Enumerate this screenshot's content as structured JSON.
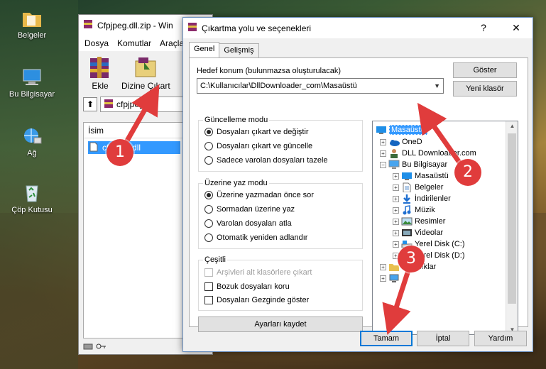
{
  "desktop": {
    "icons": [
      {
        "label": "Belgeler",
        "icon": "folder-icon"
      },
      {
        "label": "Bu Bilgisayar",
        "icon": "computer-icon"
      },
      {
        "label": "Ağ",
        "icon": "network-icon"
      },
      {
        "label": "Çöp Kutusu",
        "icon": "recycle-bin-icon"
      }
    ]
  },
  "winrar": {
    "title": "Cfpjpeg.dll.zip - Win",
    "menu": [
      "Dosya",
      "Komutlar",
      "Araçla"
    ],
    "toolbar": {
      "add_label": "Ekle",
      "extract_label": "Dizine Çıkart"
    },
    "path": "cfpjpeg.dll.",
    "column_name": "İsim",
    "file_name": "cfpjpeg.dll"
  },
  "dialog": {
    "title": "Çıkartma yolu ve seçenekleri",
    "help_btn": "?",
    "close_btn": "✕",
    "tabs": [
      "Genel",
      "Gelişmiş"
    ],
    "dest_label": "Hedef konum (bulunmazsa oluşturulacak)",
    "dest_value": "C:\\Kullanıcılar\\DllDownloader_com\\Masaüstü",
    "show_btn": "Göster",
    "new_folder_btn": "Yeni klasör",
    "update_mode": {
      "title": "Güncelleme modu",
      "options": [
        "Dosyaları çıkart ve değiştir",
        "Dosyaları çıkart ve güncelle",
        "Sadece varolan dosyaları tazele"
      ],
      "selected": 0
    },
    "overwrite_mode": {
      "title": "Üzerine yaz modu",
      "options": [
        "Üzerine yazmadan önce sor",
        "Sormadan üzerine yaz",
        "Varolan dosyaları atla",
        "Otomatik yeniden adlandır"
      ],
      "selected": 0
    },
    "misc": {
      "title": "Çeşitli",
      "options": [
        {
          "label": "Arşivleri alt klasörlere çıkart",
          "disabled": true
        },
        {
          "label": "Bozuk dosyaları koru",
          "disabled": false
        },
        {
          "label": "Dosyaları Gezginde göster",
          "disabled": false
        }
      ]
    },
    "save_settings_btn": "Ayarları kaydet",
    "tree": [
      {
        "label": "Masaüstü",
        "icon": "desktop-folder-icon",
        "selected": true
      },
      {
        "label": "OneD",
        "icon": "onedrive-icon"
      },
      {
        "label": "DLL Downloader.com",
        "icon": "user-icon"
      },
      {
        "label": "Bu Bilgisayar",
        "icon": "computer-icon"
      },
      {
        "label": "Masaüstü",
        "icon": "desktop-folder-icon"
      },
      {
        "label": "Belgeler",
        "icon": "documents-icon"
      },
      {
        "label": "İndirilenler",
        "icon": "downloads-icon"
      },
      {
        "label": "Müzik",
        "icon": "music-icon"
      },
      {
        "label": "Resimler",
        "icon": "pictures-icon"
      },
      {
        "label": "Videolar",
        "icon": "videos-icon"
      },
      {
        "label": "Yerel Disk (C:)",
        "icon": "drive-icon"
      },
      {
        "label": "Yerel Disk (D:)",
        "icon": "drive-icon"
      },
      {
        "label": "Kitaplıklar",
        "icon": "libraries-icon"
      },
      {
        "label": "",
        "icon": "network-icon"
      }
    ],
    "ok_btn": "Tamam",
    "cancel_btn": "İptal",
    "help_button": "Yardım"
  },
  "annotations": {
    "step1": "1",
    "step2": "2",
    "step3": "3"
  }
}
